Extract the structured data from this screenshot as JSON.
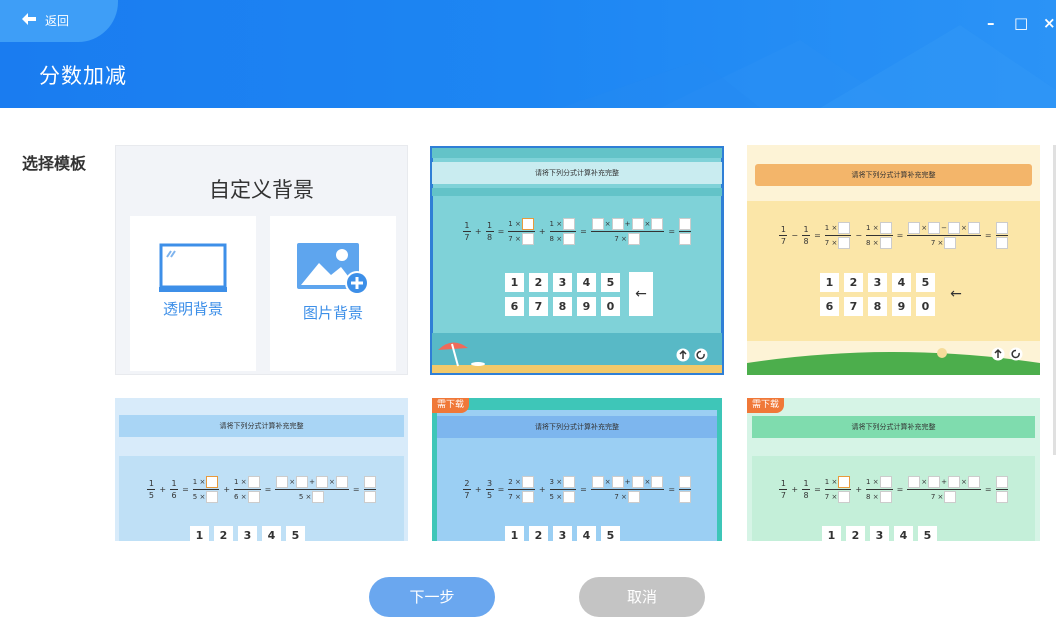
{
  "header": {
    "back_label": "返回",
    "title": "分数加减",
    "minimize": "–",
    "maximize": "□",
    "close": "×"
  },
  "section_label": "选择模板",
  "custom_background": {
    "title": "自定义背景",
    "transparent_label": "透明背景",
    "image_label": "图片背景"
  },
  "templates": [
    {
      "heading": "请将下列分式计算补充完整",
      "fractions": [
        "1",
        "7",
        "1",
        "8"
      ],
      "ops": [
        "+",
        "+",
        "+"
      ],
      "denoms": [
        "7 ×",
        "8 ×",
        "7 ×"
      ],
      "selected": true,
      "download_tag": ""
    },
    {
      "heading": "请将下列分式计算补充完整",
      "fractions": [
        "1",
        "7",
        "1",
        "8"
      ],
      "ops": [
        "−",
        "−",
        "−"
      ],
      "denoms": [
        "7 ×",
        "8 ×",
        "7 ×"
      ],
      "selected": false,
      "download_tag": ""
    },
    {
      "heading": "请将下列分式计算补充完整",
      "fractions": [
        "1",
        "5",
        "1",
        "6"
      ],
      "ops": [
        "+",
        "+",
        "+"
      ],
      "denoms": [
        "5 ×",
        "6 ×",
        "5 ×"
      ],
      "selected": false,
      "download_tag": ""
    },
    {
      "heading": "请将下列分式计算补充完整",
      "fractions": [
        "2",
        "7",
        "3",
        "5"
      ],
      "ops": [
        "+",
        "+",
        "+"
      ],
      "denoms": [
        "7 ×",
        "5 ×",
        "7 ×"
      ],
      "selected": false,
      "download_tag": "需下载"
    },
    {
      "heading": "请将下列分式计算补充完整",
      "fractions": [
        "1",
        "7",
        "1",
        "8"
      ],
      "ops": [
        "+",
        "+",
        "+"
      ],
      "denoms": [
        "7 ×",
        "8 ×",
        "7 ×"
      ],
      "selected": false,
      "download_tag": "需下载"
    }
  ],
  "keypad": {
    "row1": [
      "1",
      "2",
      "3",
      "4",
      "5"
    ],
    "row2": [
      "6",
      "7",
      "8",
      "9",
      "0"
    ],
    "backspace": "←"
  },
  "numerator_mark": "1 ×",
  "mult_mark": "×",
  "eq": "=",
  "buttons": {
    "next": "下一步",
    "cancel": "取消"
  },
  "colors": {
    "header": "#1d86f3",
    "accent": "#3d8fe8",
    "download_tag": "#f07838",
    "next_button": "#6aa7ef",
    "cancel_button": "#c4c4c4"
  }
}
